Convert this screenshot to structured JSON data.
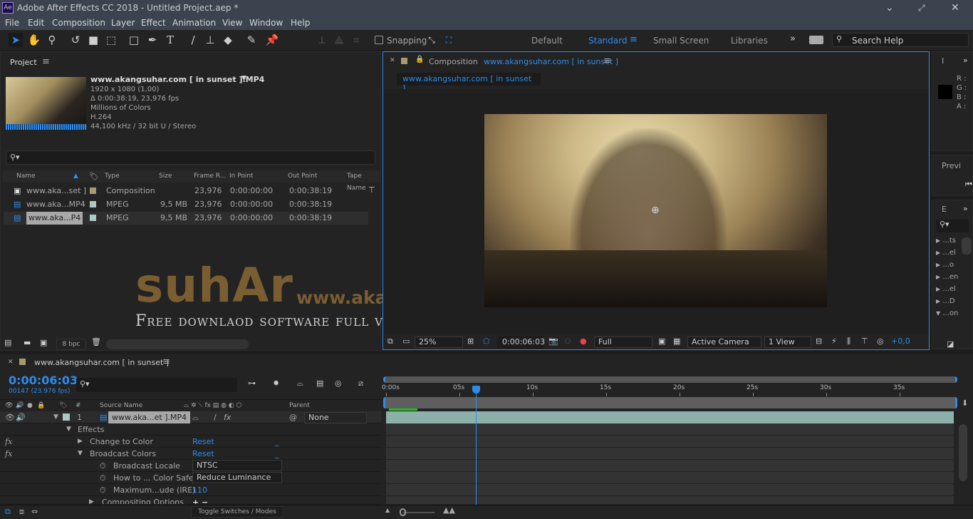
{
  "app": {
    "logo": "Ae",
    "title": "Adobe After Effects CC 2018 - Untitled Project.aep *"
  },
  "menu": [
    "File",
    "Edit",
    "Composition",
    "Layer",
    "Effect",
    "Animation",
    "View",
    "Window",
    "Help"
  ],
  "toolbar": {
    "snapping": "Snapping",
    "workspaces": [
      "Default",
      "Standard",
      "Small Screen",
      "Libraries"
    ],
    "active_workspace": "Standard",
    "search_placeholder": "Search Help"
  },
  "project": {
    "title": "Project",
    "selected": {
      "name": "www.akangsuhar.com [ in sunset ].MP4",
      "info": [
        "1920 x 1080 (1,00)",
        "Δ 0:00:38:19, 23,976 fps",
        "Millions of Colors",
        "H.264",
        "44,100 kHz / 32 bit U / Stereo"
      ]
    },
    "columns": [
      "Name",
      "Type",
      "Size",
      "Frame R...",
      "In Point",
      "Out Point",
      "Tape Name"
    ],
    "items": [
      {
        "name": "www.aka...set ]",
        "type": "Composition",
        "size": "",
        "fps": "23,976",
        "in": "0:00:00:00",
        "out": "0:00:38:19",
        "label": "#a89a6e"
      },
      {
        "name": "www.aka...MP4",
        "type": "MPEG",
        "size": "9,5 MB",
        "fps": "23,976",
        "in": "0:00:00:00",
        "out": "0:00:38:19",
        "label": "#a9c9c5"
      },
      {
        "name": "www.aka...P4",
        "type": "MPEG",
        "size": "9,5 MB",
        "fps": "23,976",
        "in": "0:00:00:00",
        "out": "0:00:38:19",
        "label": "#a9c9c5"
      }
    ],
    "bpc": "8 bpc"
  },
  "composition": {
    "tab_prefix": "Composition",
    "tab_name": "www.akangsuhar.com [ in sunset ]",
    "breadcrumb": "www.akangsuhar.com [ in sunset ]",
    "zoom": "25%",
    "time": "0:00:06:03",
    "resolution": "Full",
    "camera": "Active Camera",
    "views": "1 View",
    "exposure": "+0,0"
  },
  "info_panel": {
    "tab": "I",
    "labels": [
      "R :",
      "G :",
      "B :",
      "A :"
    ]
  },
  "preview_panel": {
    "tab": "Previ"
  },
  "effects_panel": {
    "tab": "E",
    "items": [
      "...ts",
      "...el",
      "...o",
      "...en",
      "...el",
      "...D",
      "...on"
    ]
  },
  "watermark": {
    "brand": "suhAr",
    "url": "www.akangsuhar.com",
    "tagline": "Free downlaod software full version"
  },
  "timeline": {
    "tab": "www.akangsuhar.com [ in sunset ]",
    "current_time": "0:00:06:03",
    "frame_info": "00147 (23.976 fps)",
    "columns": {
      "num": "#",
      "source": "Source Name",
      "parent": "Parent"
    },
    "layer": {
      "num": "1",
      "name": "www.aka...et ].MP4",
      "parent": "None"
    },
    "effects_label": "Effects",
    "effects": [
      {
        "name": "Change to Color",
        "reset": "Reset",
        "expanded": false
      },
      {
        "name": "Broadcast Colors",
        "reset": "Reset",
        "expanded": true
      }
    ],
    "props": [
      {
        "name": "Broadcast Locale",
        "value": "NTSC",
        "type": "dropdown"
      },
      {
        "name": "How to ... Color Safe",
        "value": "Reduce Luminance",
        "type": "dropdown"
      },
      {
        "name": "Maximum...ude (IRE)",
        "value": "110",
        "type": "number"
      }
    ],
    "compositing": "Compositing Options",
    "toggle": "Toggle Switches / Modes",
    "ruler": [
      "0:00s",
      "05s",
      "10s",
      "15s",
      "20s",
      "25s",
      "30s",
      "35s"
    ],
    "ruler_seconds": [
      0,
      5,
      10,
      15,
      20,
      25,
      30,
      35
    ],
    "duration_seconds": 38.8,
    "playhead_seconds": 6.125,
    "accent": "#2d8ceb"
  }
}
